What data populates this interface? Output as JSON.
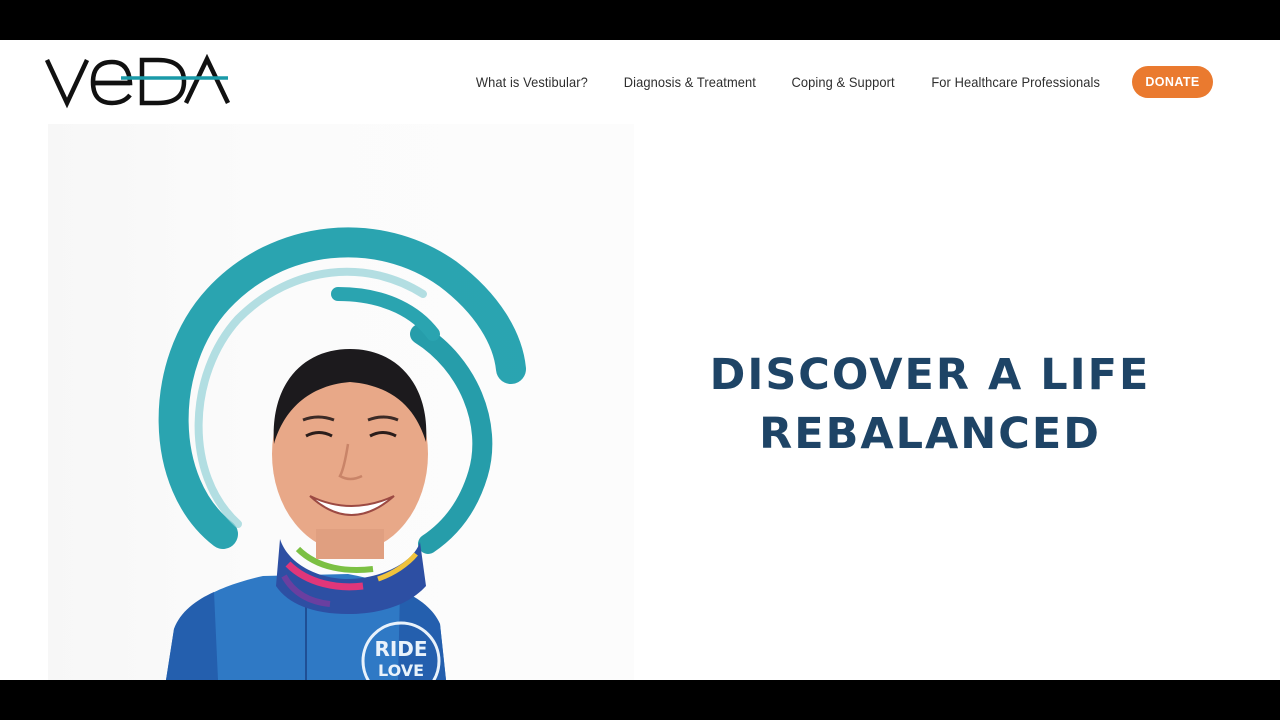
{
  "header": {
    "logo_text": "VEDA",
    "nav": [
      {
        "label": "What is Vestibular?"
      },
      {
        "label": "Diagnosis & Treatment"
      },
      {
        "label": "Coping & Support"
      },
      {
        "label": "For Healthcare Professionals"
      }
    ],
    "donate_label": "DONATE"
  },
  "hero": {
    "heading_line1": "DISCOVER A LIFE",
    "heading_line2": "REBALANCED",
    "shirt_text_line1": "RIDE",
    "shirt_text_line2": "LOVE"
  },
  "colors": {
    "accent_orange": "#ea7a2f",
    "heading_navy": "#1e4466",
    "logo_teal": "#1a9aa8",
    "swirl_teal": "#1fa0ad",
    "jersey_blue": "#2f79c5"
  }
}
